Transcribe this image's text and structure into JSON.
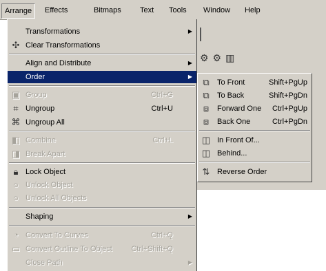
{
  "menubar": {
    "items": [
      {
        "label": "Arrange"
      },
      {
        "label": "Effects"
      },
      {
        "label": "Bitmaps"
      },
      {
        "label": "Text"
      },
      {
        "label": "Tools"
      },
      {
        "label": "Window"
      },
      {
        "label": "Help"
      }
    ]
  },
  "menu": {
    "items": [
      {
        "label": "Transformations",
        "shortcut": "",
        "submenu": true,
        "enabled": true,
        "icon": "transform-icon"
      },
      {
        "label": "Clear Transformations",
        "shortcut": "",
        "submenu": false,
        "enabled": true,
        "icon": "clear-transform-icon"
      },
      {
        "label": "Align and Distribute",
        "shortcut": "",
        "submenu": true,
        "enabled": true,
        "icon": ""
      },
      {
        "label": "Order",
        "shortcut": "",
        "submenu": true,
        "enabled": true,
        "selected": true,
        "icon": ""
      },
      {
        "label": "Group",
        "shortcut": "Ctrl+G",
        "submenu": false,
        "enabled": false,
        "icon": "group-icon"
      },
      {
        "label": "Ungroup",
        "shortcut": "Ctrl+U",
        "submenu": false,
        "enabled": true,
        "icon": "ungroup-icon"
      },
      {
        "label": "Ungroup All",
        "shortcut": "",
        "submenu": false,
        "enabled": true,
        "icon": "ungroup-all-icon"
      },
      {
        "label": "Combine",
        "shortcut": "Ctrl+L",
        "submenu": false,
        "enabled": false,
        "icon": "combine-icon"
      },
      {
        "label": "Break Apart",
        "shortcut": "",
        "submenu": false,
        "enabled": false,
        "icon": "break-apart-icon"
      },
      {
        "label": "Lock Object",
        "shortcut": "",
        "submenu": false,
        "enabled": true,
        "icon": "lock-icon"
      },
      {
        "label": "Unlock Object",
        "shortcut": "",
        "submenu": false,
        "enabled": false,
        "icon": "unlock-icon"
      },
      {
        "label": "Unlock All Objects",
        "shortcut": "",
        "submenu": false,
        "enabled": false,
        "icon": "unlock-all-icon"
      },
      {
        "label": "Shaping",
        "shortcut": "",
        "submenu": true,
        "enabled": true,
        "icon": ""
      },
      {
        "label": "Convert To Curves",
        "shortcut": "Ctrl+Q",
        "submenu": false,
        "enabled": false,
        "icon": "curves-icon"
      },
      {
        "label": "Convert Outline To Object",
        "shortcut": "Ctrl+Shift+Q",
        "submenu": false,
        "enabled": false,
        "icon": "outline-icon"
      },
      {
        "label": "Close Path",
        "shortcut": "",
        "submenu": true,
        "enabled": false,
        "icon": ""
      }
    ]
  },
  "submenu": {
    "items": [
      {
        "label": "To Front",
        "shortcut": "Shift+PgUp",
        "icon": "to-front-icon"
      },
      {
        "label": "To Back",
        "shortcut": "Shift+PgDn",
        "icon": "to-back-icon"
      },
      {
        "label": "Forward One",
        "shortcut": "Ctrl+PgUp",
        "icon": "forward-one-icon"
      },
      {
        "label": "Back One",
        "shortcut": "Ctrl+PgDn",
        "icon": "back-one-icon"
      },
      {
        "label": "In Front Of...",
        "shortcut": "",
        "icon": "in-front-of-icon"
      },
      {
        "label": "Behind...",
        "shortcut": "",
        "icon": "behind-icon"
      },
      {
        "label": "Reverse Order",
        "shortcut": "",
        "icon": "reverse-order-icon"
      }
    ]
  },
  "colors": {
    "menu_bg": "#d4d0c8",
    "highlight": "#0a246a",
    "disabled_text": "#a6a39b"
  }
}
